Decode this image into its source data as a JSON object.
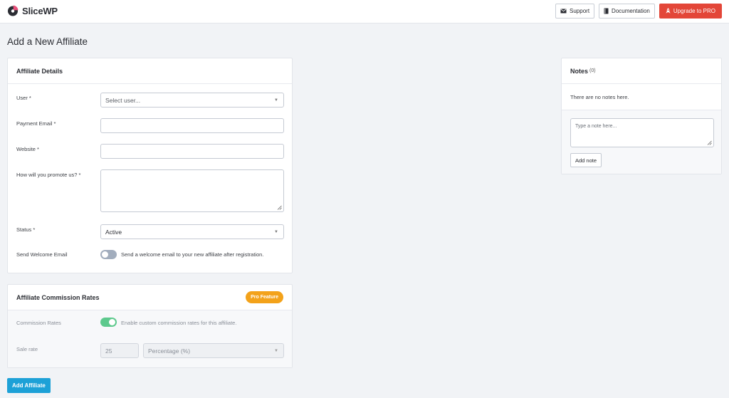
{
  "app": {
    "name": "SliceWP"
  },
  "top_actions": {
    "support": "Support",
    "documentation": "Documentation",
    "upgrade": "Upgrade to PRO"
  },
  "page": {
    "title": "Add a New Affiliate"
  },
  "details": {
    "title": "Affiliate Details",
    "user_label": "User *",
    "user_placeholder": "Select user...",
    "payment_label": "Payment Email *",
    "payment_value": "",
    "website_label": "Website *",
    "website_value": "",
    "promote_label": "How will you promote us? *",
    "promote_value": "",
    "status_label": "Status *",
    "status_value": "Active",
    "welcome_label": "Send Welcome Email",
    "welcome_text": "Send a welcome email to your new affiliate after registration.",
    "welcome_enabled": false
  },
  "rates": {
    "title": "Affiliate Commission Rates",
    "badge": "Pro Feature",
    "commission_label": "Commission Rates",
    "commission_text": "Enable custom commission rates for this affiliate.",
    "commission_enabled": true,
    "sale_label": "Sale rate",
    "sale_value": "25",
    "sale_type": "Percentage (%)"
  },
  "submit": {
    "label": "Add Affiliate"
  },
  "notes": {
    "title": "Notes",
    "count": "(0)",
    "empty": "There are no notes here.",
    "placeholder": "Type a note here...",
    "add_label": "Add note"
  },
  "colors": {
    "brand_pink": "#e8507a",
    "upgrade": "#e34638",
    "primary": "#1da1d7",
    "pro_badge": "#f3a21a",
    "toggle_on": "#5dc98d"
  },
  "icons": {
    "support": "envelope-icon",
    "documentation": "book-icon",
    "upgrade": "rocket-icon",
    "select": "chevron-down-icon",
    "resize": "resize-grip-icon"
  }
}
